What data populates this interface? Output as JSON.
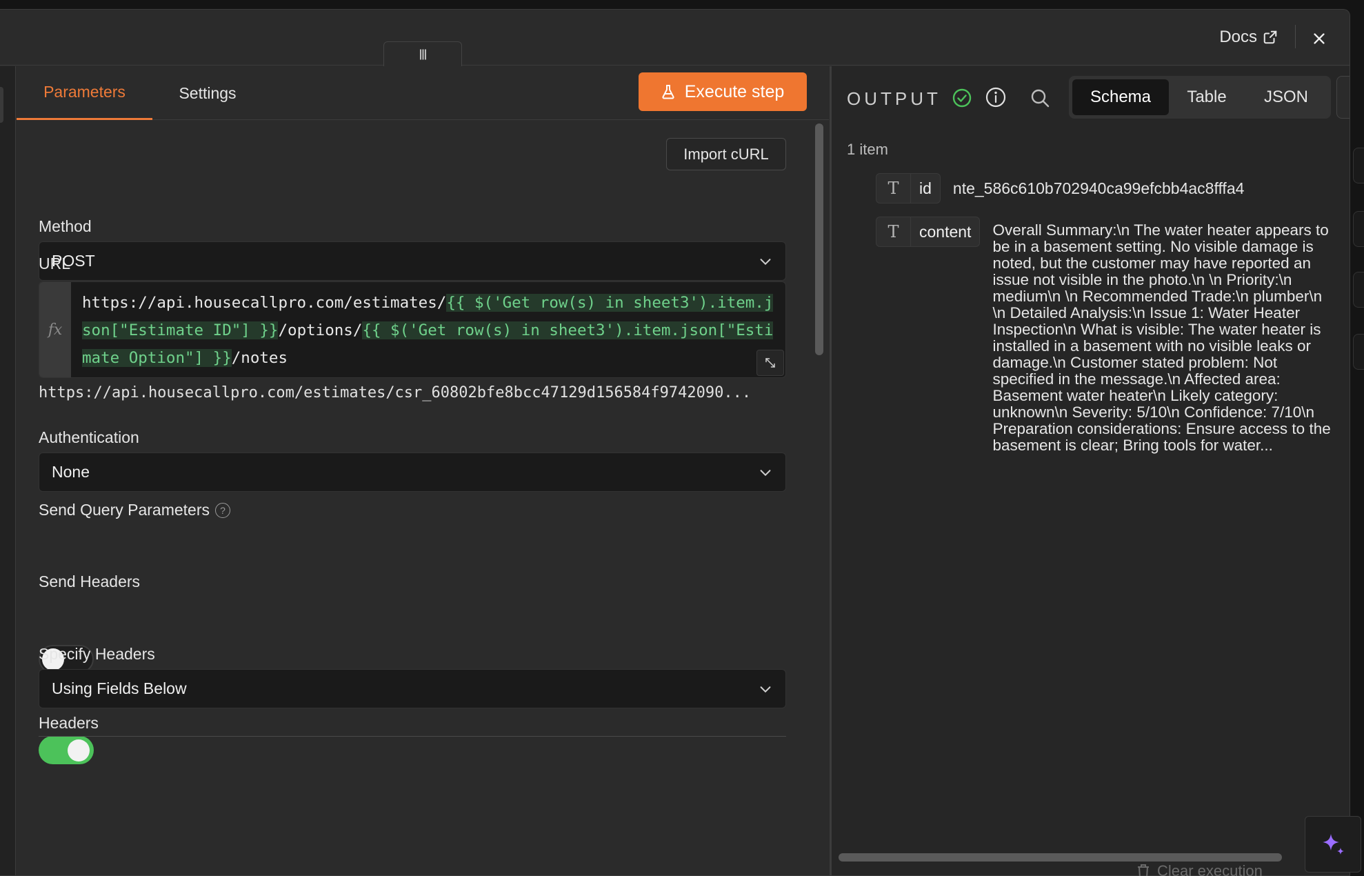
{
  "header": {
    "docs_label": "Docs",
    "handle_glyph": "|||",
    "icons": {
      "docs": "external-link-icon",
      "close": "close-icon"
    }
  },
  "params": {
    "tabs": {
      "parameters": "Parameters",
      "settings": "Settings"
    },
    "active_tab": "Parameters",
    "execute_label": "Execute step",
    "import_curl_label": "Import cURL",
    "method": {
      "label": "Method",
      "value": "POST"
    },
    "url": {
      "label": "URL",
      "fx_label": "fx",
      "part1": "https://api.housecallpro.com/estimates/",
      "expr1": "{{ $('Get row(s) in sheet3').item.json[\"Estimate ID\"] }}",
      "part2": "/options/",
      "expr2": "{{ $('Get row(s) in sheet3').item.json[\"Estimate Option\"] }}",
      "part3": "/notes",
      "preview": "https://api.housecallpro.com/estimates/csr_60802bfe8bcc47129d156584f9742090..."
    },
    "authentication": {
      "label": "Authentication",
      "value": "None"
    },
    "send_query": {
      "label": "Send Query Parameters",
      "enabled": false
    },
    "send_headers": {
      "label": "Send Headers",
      "enabled": true
    },
    "specify_headers": {
      "label": "Specify Headers",
      "value": "Using Fields Below"
    },
    "headers_label": "Headers"
  },
  "output": {
    "title": "OUTPUT",
    "views": {
      "schema": "Schema",
      "table": "Table",
      "json": "JSON"
    },
    "active_view": "Schema",
    "item_count": "1 item",
    "fields": {
      "id": {
        "type_glyph": "T",
        "key": "id",
        "value": "nte_586c610b702940ca99efcbb4ac8fffa4"
      },
      "content": {
        "type_glyph": "T",
        "key": "content",
        "value": "Overall Summary:\\n The water heater appears to be in a basement setting. No visible damage is noted, but the customer may have reported an issue not visible in the photo.\\n \\n Priority:\\n medium\\n \\n Recommended Trade:\\n plumber\\n \\n Detailed Analysis:\\n Issue 1: Water Heater Inspection\\n What is visible: The water heater is installed in a basement with no visible leaks or damage.\\n Customer stated problem: Not specified in the message.\\n Affected area: Basement water heater\\n Likely category: unknown\\n Severity: 5/10\\n Confidence: 7/10\\n Preparation considerations: Ensure access to the basement is clear; Bring tools for water..."
      }
    }
  },
  "footer": {
    "clear_execution": "Clear execution"
  },
  "colors": {
    "accent": "#ef7630",
    "success": "#4cc25a",
    "expression": "#6fd18b"
  }
}
